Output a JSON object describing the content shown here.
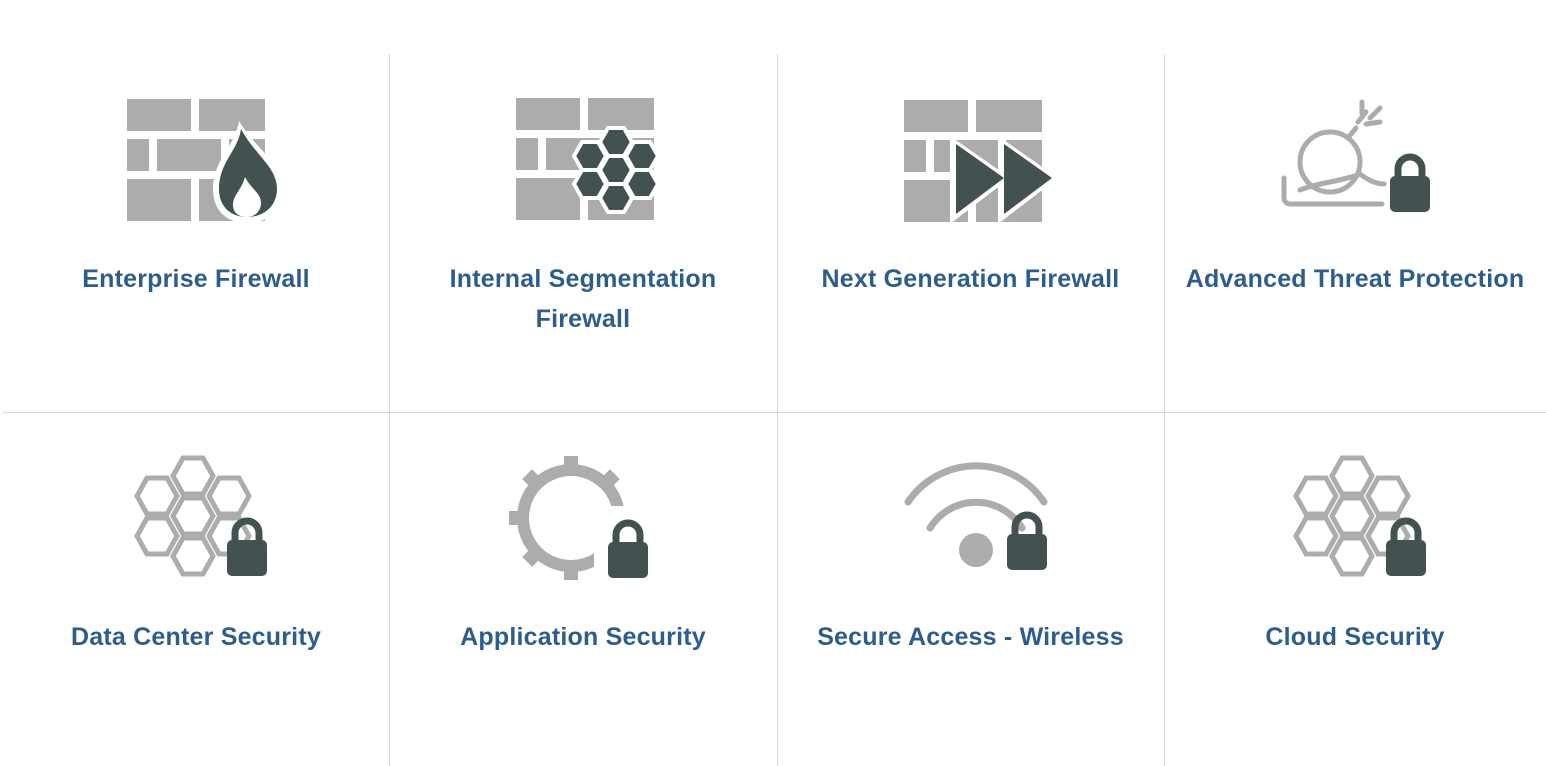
{
  "colors": {
    "label": "#2c5d8c",
    "icon_light": "#acacac",
    "icon_dark": "#435151",
    "divider": "#d6d6d6"
  },
  "tiles": [
    {
      "label": "Enterprise Firewall",
      "icon": "firewall-flame-icon"
    },
    {
      "label": "Internal Segmentation Firewall",
      "icon": "firewall-hexagon-icon"
    },
    {
      "label": "Next Generation Firewall",
      "icon": "firewall-fast-forward-icon"
    },
    {
      "label": "Advanced Threat Protection",
      "icon": "bomb-lock-icon"
    },
    {
      "label": "Data Center Security",
      "icon": "hexagon-cluster-lock-icon"
    },
    {
      "label": "Application Security",
      "icon": "gear-lock-icon"
    },
    {
      "label": "Secure Access - Wireless",
      "icon": "wifi-lock-icon"
    },
    {
      "label": "Cloud Security",
      "icon": "hexagon-cluster-lock-icon"
    }
  ]
}
